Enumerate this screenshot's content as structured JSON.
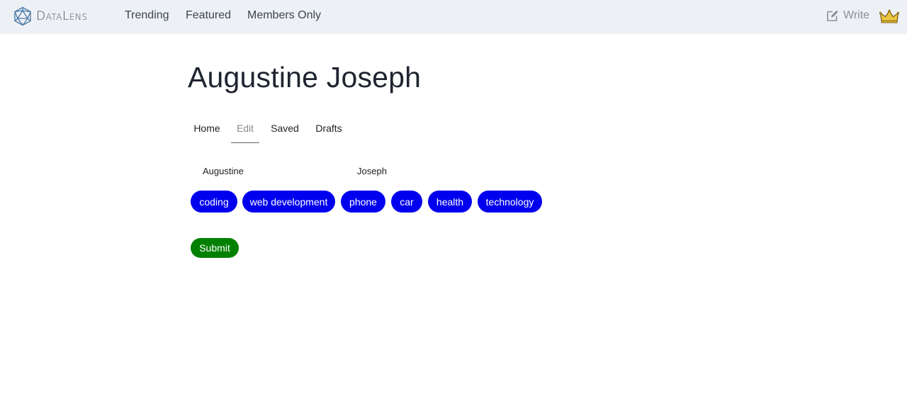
{
  "header": {
    "logo_text": "DataLens",
    "nav": [
      {
        "label": "Trending"
      },
      {
        "label": "Featured"
      },
      {
        "label": "Members Only"
      }
    ],
    "write_label": "Write",
    "crown_color": "#e8c440"
  },
  "profile": {
    "name": "Augustine Joseph",
    "tabs": [
      {
        "label": "Home"
      },
      {
        "label": "Edit",
        "active": true
      },
      {
        "label": "Saved"
      },
      {
        "label": "Drafts"
      }
    ],
    "first_name": "Augustine",
    "last_name": "Joseph",
    "tags": [
      {
        "label": "coding"
      },
      {
        "label": "web development"
      },
      {
        "label": "phone"
      },
      {
        "label": "car"
      },
      {
        "label": "health"
      },
      {
        "label": "technology"
      }
    ],
    "submit_label": "Submit",
    "tag_color": "#0000ee",
    "submit_color": "#008000"
  }
}
